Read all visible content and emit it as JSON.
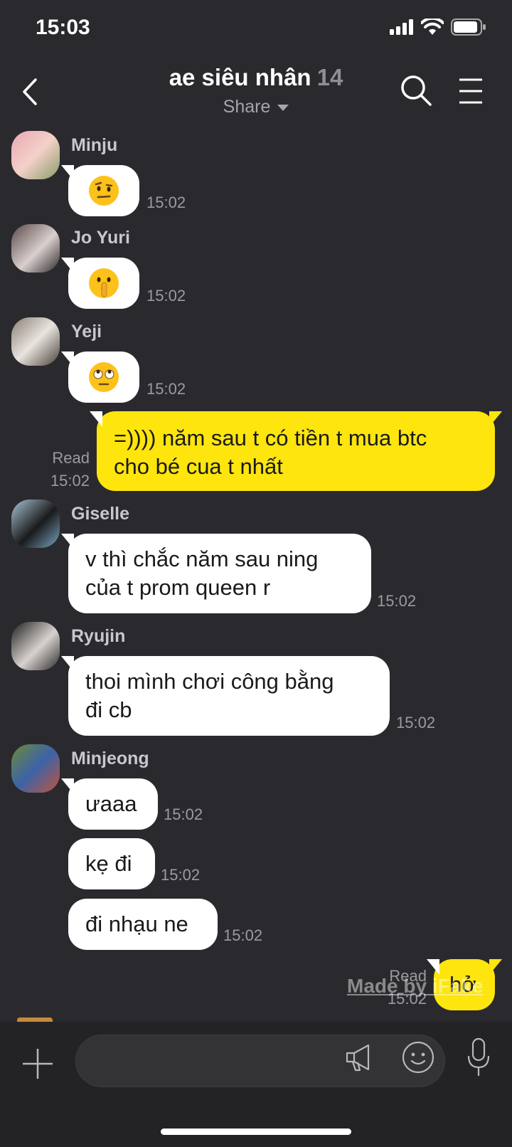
{
  "status": {
    "time": "15:03"
  },
  "header": {
    "title": "ae siêu nhân",
    "member_count": "14",
    "subtitle": "Share"
  },
  "messages": {
    "m1": {
      "sender": "Minju",
      "time": "15:02"
    },
    "m2": {
      "sender": "Jo Yuri",
      "time": "15:02"
    },
    "m3": {
      "sender": "Yeji",
      "time": "15:02"
    },
    "m4": {
      "text_line1": "=)))) năm sau t có tiền t mua btc",
      "text_line2": "cho bé cua t nhất",
      "read": "Read",
      "time": "15:02"
    },
    "m5": {
      "sender": "Giselle",
      "text_line1": "v thì chắc năm sau ning",
      "text_line2": "của t prom queen r",
      "time": "15:02"
    },
    "m6": {
      "sender": "Ryujin",
      "text_line1": "thoi mình chơi công bằng",
      "text_line2": "đi cb",
      "time": "15:02"
    },
    "m7": {
      "sender": "Minjeong",
      "text": "ưaaa",
      "time": "15:02"
    },
    "m8": {
      "text": "kẹ đi",
      "time": "15:02"
    },
    "m9": {
      "text": "đi nhạu ne",
      "time": "15:02"
    },
    "m10": {
      "text": "hở",
      "read": "Read",
      "time": "15:02"
    }
  },
  "watermark": "Made by iFake",
  "input": {
    "placeholder": ""
  },
  "colors": {
    "background": "#2a2a2e",
    "my_bubble": "#fde50d",
    "their_bubble": "#ffffff"
  },
  "icons": [
    "back-icon",
    "search-icon",
    "menu-icon",
    "plus-icon",
    "megaphone-icon",
    "smiley-icon",
    "mic-icon"
  ]
}
